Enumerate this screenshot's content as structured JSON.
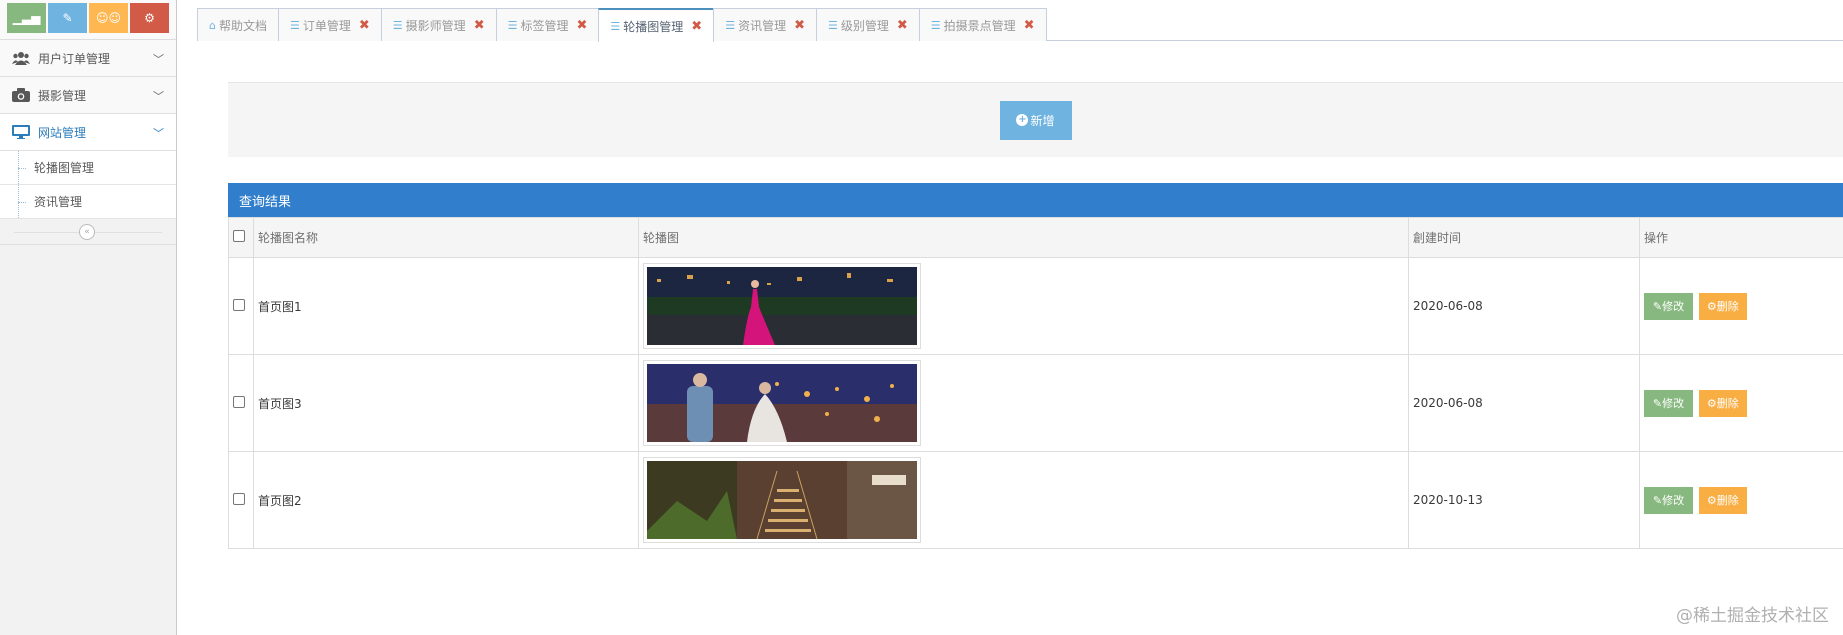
{
  "sidebar": {
    "shortcuts": [
      {
        "icon": "signal-icon",
        "color": "#87b87f"
      },
      {
        "icon": "pencil-icon",
        "color": "#6fb3e0"
      },
      {
        "icon": "group-icon",
        "color": "#ffb752"
      },
      {
        "icon": "cogs-icon",
        "color": "#d15b47"
      }
    ],
    "menu": [
      {
        "label": "用户订单管理",
        "icon": "users-icon"
      },
      {
        "label": "摄影管理",
        "icon": "camera-icon"
      },
      {
        "label": "网站管理",
        "icon": "desktop-icon"
      }
    ],
    "submenu": [
      {
        "label": "轮播图管理"
      },
      {
        "label": "资讯管理"
      }
    ]
  },
  "tabs": [
    {
      "label": "帮助文档",
      "icon": "home-icon",
      "closable": false
    },
    {
      "label": "订单管理",
      "icon": "sliders-icon",
      "closable": true
    },
    {
      "label": "摄影师管理",
      "icon": "sliders-icon",
      "closable": true
    },
    {
      "label": "标签管理",
      "icon": "sliders-icon",
      "closable": true
    },
    {
      "label": "轮播图管理",
      "icon": "sliders-icon",
      "closable": true,
      "active": true
    },
    {
      "label": "资讯管理",
      "icon": "sliders-icon",
      "closable": true
    },
    {
      "label": "级别管理",
      "icon": "sliders-icon",
      "closable": true
    },
    {
      "label": "拍摄景点管理",
      "icon": "sliders-icon",
      "closable": true
    }
  ],
  "toolbar": {
    "add_label": "新增"
  },
  "results": {
    "title": "查询结果",
    "columns": [
      "轮播图名称",
      "轮播图",
      "創建时间",
      "操作"
    ],
    "rows": [
      {
        "name": "首页图1",
        "created": "2020-06-08"
      },
      {
        "name": "首页图3",
        "created": "2020-06-08"
      },
      {
        "name": "首页图2",
        "created": "2020-10-13"
      }
    ],
    "edit_label": "修改",
    "delete_label": "删除"
  },
  "watermark": "@稀土掘金技术社区"
}
